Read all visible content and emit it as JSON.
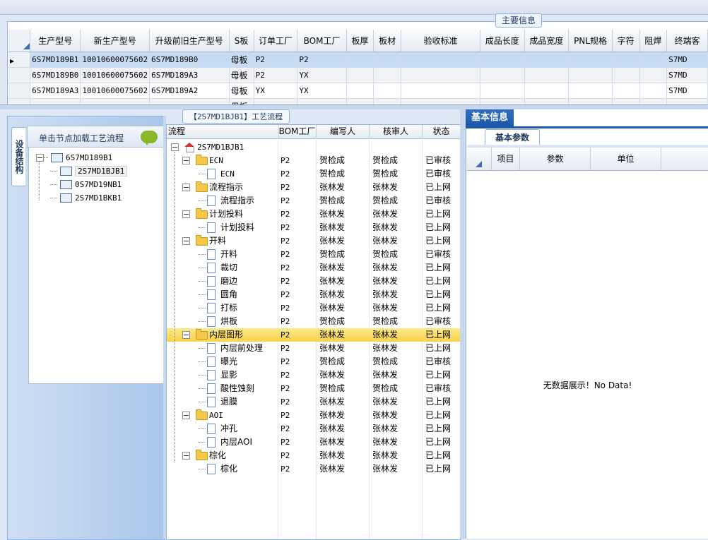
{
  "main_info": {
    "legend": "主要信息",
    "columns": [
      "生产型号",
      "新生产型号",
      "升级前旧生产型号",
      "S板",
      "订单工厂",
      "BOM工厂",
      "板厚",
      "板材",
      "验收标准",
      "成品长度",
      "成品宽度",
      "PNL规格",
      "字符",
      "阻焊",
      "终端客"
    ],
    "rows": [
      [
        "6S7MD189B1",
        "10010600075602",
        "6S7MD189B0",
        "母板",
        "P2",
        "P2",
        "",
        "",
        "",
        "",
        "",
        "",
        "",
        "",
        "S7MD"
      ],
      [
        "6S7MD189B0",
        "10010600075602",
        "6S7MD189A3",
        "母板",
        "P2",
        "YX",
        "",
        "",
        "",
        "",
        "",
        "",
        "",
        "",
        "S7MD"
      ],
      [
        "6S7MD189A3",
        "10010600075602",
        "6S7MD189A2",
        "母板",
        "YX",
        "YX",
        "",
        "",
        "",
        "",
        "",
        "",
        "",
        "",
        "S7MD"
      ],
      [
        "",
        "",
        "",
        "母板",
        "",
        "",
        "",
        "",
        "",
        "",
        "",
        "",
        "",
        "",
        ""
      ]
    ]
  },
  "device": {
    "side_tab": "设备结构",
    "title": "单击节点加载工艺流程",
    "root": "6S7MD189B1",
    "children": [
      "2S7MD1BJB1",
      "0S7MD19NB1",
      "2S7MD1BKB1"
    ]
  },
  "process": {
    "tab": "【2S7MD1BJB1】工艺流程",
    "headers": [
      "流程",
      "BOM工厂",
      "编写人",
      "核审人",
      "状态"
    ],
    "root": "2S7MD1BJB1",
    "rows": [
      {
        "level": 1,
        "type": "folder",
        "name": "ECN",
        "bom": "P2",
        "writer": "贺检成",
        "reviewer": "贺检成",
        "status": "已审核"
      },
      {
        "level": 2,
        "type": "doc",
        "name": "ECN",
        "bom": "P2",
        "writer": "贺检成",
        "reviewer": "贺检成",
        "status": "已审核"
      },
      {
        "level": 1,
        "type": "folder",
        "name": "流程指示",
        "bom": "P2",
        "writer": "张林发",
        "reviewer": "张林发",
        "status": "已上网"
      },
      {
        "level": 2,
        "type": "doc",
        "name": "流程指示",
        "bom": "P2",
        "writer": "贺检成",
        "reviewer": "贺检成",
        "status": "已审核"
      },
      {
        "level": 1,
        "type": "folder",
        "name": "计划投料",
        "bom": "P2",
        "writer": "张林发",
        "reviewer": "张林发",
        "status": "已上网"
      },
      {
        "level": 2,
        "type": "doc",
        "name": "计划投料",
        "bom": "P2",
        "writer": "张林发",
        "reviewer": "张林发",
        "status": "已上网"
      },
      {
        "level": 1,
        "type": "folder",
        "name": "开料",
        "bom": "P2",
        "writer": "张林发",
        "reviewer": "张林发",
        "status": "已上网"
      },
      {
        "level": 2,
        "type": "doc",
        "name": "开料",
        "bom": "P2",
        "writer": "贺检成",
        "reviewer": "贺检成",
        "status": "已审核"
      },
      {
        "level": 2,
        "type": "doc",
        "name": "裁切",
        "bom": "P2",
        "writer": "张林发",
        "reviewer": "张林发",
        "status": "已上网"
      },
      {
        "level": 2,
        "type": "doc",
        "name": "磨边",
        "bom": "P2",
        "writer": "张林发",
        "reviewer": "张林发",
        "status": "已上网"
      },
      {
        "level": 2,
        "type": "doc",
        "name": "圆角",
        "bom": "P2",
        "writer": "张林发",
        "reviewer": "张林发",
        "status": "已上网"
      },
      {
        "level": 2,
        "type": "doc",
        "name": "打标",
        "bom": "P2",
        "writer": "张林发",
        "reviewer": "张林发",
        "status": "已上网"
      },
      {
        "level": 2,
        "type": "doc",
        "name": "烘板",
        "bom": "P2",
        "writer": "贺检成",
        "reviewer": "贺检成",
        "status": "已审核"
      },
      {
        "level": 1,
        "type": "folder",
        "name": "内层图形",
        "bom": "P2",
        "writer": "张林发",
        "reviewer": "张林发",
        "status": "已上网",
        "highlight": true
      },
      {
        "level": 2,
        "type": "doc",
        "name": "内层前处理",
        "bom": "P2",
        "writer": "张林发",
        "reviewer": "张林发",
        "status": "已上网"
      },
      {
        "level": 2,
        "type": "doc",
        "name": "曝光",
        "bom": "P2",
        "writer": "贺检成",
        "reviewer": "贺检成",
        "status": "已审核"
      },
      {
        "level": 2,
        "type": "doc",
        "name": "显影",
        "bom": "P2",
        "writer": "张林发",
        "reviewer": "张林发",
        "status": "已上网"
      },
      {
        "level": 2,
        "type": "doc",
        "name": "酸性蚀刻",
        "bom": "P2",
        "writer": "贺检成",
        "reviewer": "贺检成",
        "status": "已审核"
      },
      {
        "level": 2,
        "type": "doc",
        "name": "退膜",
        "bom": "P2",
        "writer": "张林发",
        "reviewer": "张林发",
        "status": "已上网"
      },
      {
        "level": 1,
        "type": "folder",
        "name": "AOI",
        "bom": "P2",
        "writer": "张林发",
        "reviewer": "张林发",
        "status": "已上网"
      },
      {
        "level": 2,
        "type": "doc",
        "name": "冲孔",
        "bom": "P2",
        "writer": "张林发",
        "reviewer": "张林发",
        "status": "已上网"
      },
      {
        "level": 2,
        "type": "doc",
        "name": "内层AOI",
        "bom": "P2",
        "writer": "张林发",
        "reviewer": "张林发",
        "status": "已上网"
      },
      {
        "level": 1,
        "type": "folder",
        "name": "棕化",
        "bom": "P2",
        "writer": "张林发",
        "reviewer": "张林发",
        "status": "已上网"
      },
      {
        "level": 2,
        "type": "doc",
        "name": "棕化",
        "bom": "P2",
        "writer": "张林发",
        "reviewer": "张林发",
        "status": "已上网"
      }
    ]
  },
  "basic": {
    "tab": "基本信息",
    "subtab": "基本参数",
    "headers": [
      "项目",
      "参数",
      "单位"
    ],
    "empty_text": "无数据展示！No Data!"
  },
  "colors": {
    "accent": "#1b56a8",
    "highlight": "#f7d24a",
    "selected_row": "#c6dcf4"
  }
}
